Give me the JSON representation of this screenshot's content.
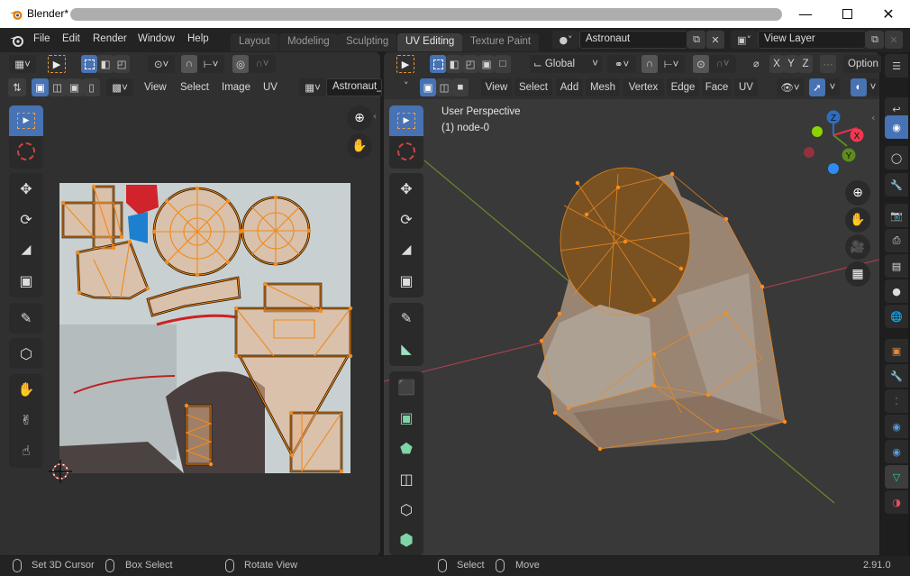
{
  "window": {
    "title": "Blender*",
    "minimize_icon": "minimize-icon",
    "maximize_icon": "maximize-icon",
    "close_icon": "close-icon"
  },
  "menubar": {
    "items": [
      "File",
      "Edit",
      "Render",
      "Window",
      "Help"
    ]
  },
  "workspaces": {
    "tabs": [
      "Layout",
      "Modeling",
      "Sculpting",
      "UV Editing",
      "Texture Paint"
    ],
    "active": "UV Editing"
  },
  "scene": {
    "name": "Astronaut",
    "view_layer": "View Layer"
  },
  "uv_editor": {
    "menus": [
      "View",
      "Select",
      "Image",
      "UV"
    ],
    "image_name": "Astronaut_",
    "tools": [
      "select-box",
      "cursor",
      "move",
      "rotate",
      "scale",
      "transform",
      "annotate",
      "rip",
      "grab",
      "relax",
      "pinch"
    ]
  },
  "viewport": {
    "transform_orientation": "Global",
    "options_label": "Option",
    "axis_buttons": [
      "X",
      "Y",
      "Z"
    ],
    "menus": [
      "View",
      "Select",
      "Add",
      "Mesh",
      "Vertex",
      "Edge",
      "Face",
      "UV"
    ],
    "overlay_line1": "User Perspective",
    "overlay_line2": "(1) node-0",
    "gizmo_axes": [
      "X",
      "Y",
      "Z"
    ],
    "tools": [
      "select-box",
      "cursor",
      "move",
      "rotate",
      "scale",
      "transform",
      "annotate",
      "measure",
      "extrude",
      "inset",
      "bevel",
      "loop-cut",
      "knife",
      "poly-build"
    ]
  },
  "statusbar": {
    "hints": [
      "Set 3D Cursor",
      "Box Select",
      "Rotate View",
      "Select",
      "Move"
    ],
    "version": "2.91.0"
  },
  "colors": {
    "accent_blue": "#4772b3",
    "selection_orange": "#f08a1c",
    "axis_x": "#ff3352",
    "axis_y": "#8bdc00",
    "axis_z": "#2890ff"
  }
}
